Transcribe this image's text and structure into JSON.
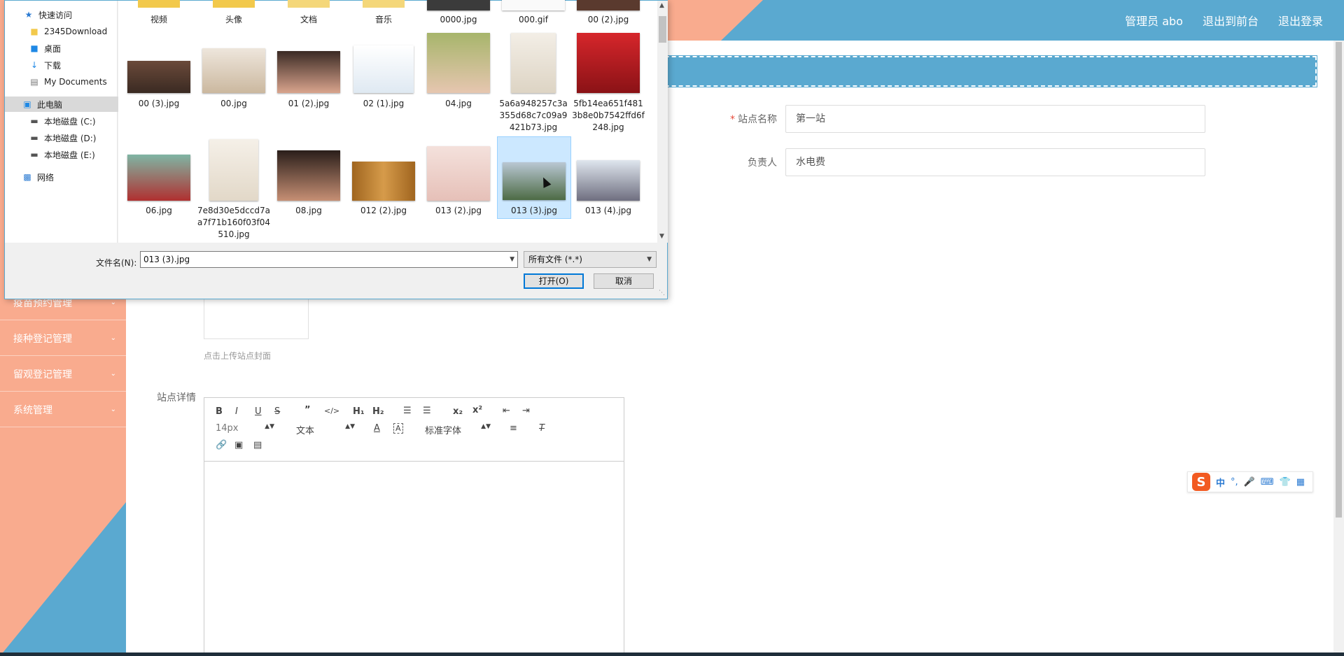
{
  "header": {
    "nav": [
      "管理员 abo",
      "退出到前台",
      "退出登录"
    ]
  },
  "sidebar": {
    "items": [
      {
        "label": "疫苗预约管理"
      },
      {
        "label": "接种登记管理"
      },
      {
        "label": "留观登记管理"
      },
      {
        "label": "系统管理"
      }
    ]
  },
  "form": {
    "station_name_label": "站点名称",
    "station_name_value": "第一站",
    "manager_label": "负责人",
    "manager_value": "水电费",
    "upload_hint": "点击上传站点封面",
    "detail_label": "站点详情"
  },
  "editor": {
    "font_size": "14px",
    "text_type": "文本",
    "font_family": "标准字体"
  },
  "file_dialog": {
    "nav": [
      {
        "label": "快速访问",
        "icon": "star-icon"
      },
      {
        "label": "2345Download",
        "icon": "folder-icon",
        "pinned": true
      },
      {
        "label": "桌面",
        "icon": "desktop-icon",
        "pinned": true
      },
      {
        "label": "下载",
        "icon": "download-icon",
        "pinned": true
      },
      {
        "label": "My Documents",
        "icon": "document-icon",
        "pinned": true
      },
      {
        "label": "此电脑",
        "icon": "computer-icon",
        "selected": true
      },
      {
        "label": "本地磁盘 (C:)",
        "icon": "drive-icon"
      },
      {
        "label": "本地磁盘 (D:)",
        "icon": "drive-icon"
      },
      {
        "label": "本地磁盘 (E:)",
        "icon": "drive-icon"
      },
      {
        "label": "网络",
        "icon": "network-icon"
      }
    ],
    "files": [
      {
        "name": "视频",
        "kind": "folder"
      },
      {
        "name": "头像",
        "kind": "folder"
      },
      {
        "name": "文档",
        "kind": "folder"
      },
      {
        "name": "音乐",
        "kind": "folder"
      },
      {
        "name": "0000.jpg",
        "kind": "image"
      },
      {
        "name": "000.gif",
        "kind": "image"
      },
      {
        "name": "00 (2).jpg",
        "kind": "image"
      },
      {
        "name": "00 (3).jpg",
        "kind": "image"
      },
      {
        "name": "00.jpg",
        "kind": "image"
      },
      {
        "name": "01 (2).jpg",
        "kind": "image"
      },
      {
        "name": "02 (1).jpg",
        "kind": "image"
      },
      {
        "name": "04.jpg",
        "kind": "image"
      },
      {
        "name": "5a6a948257c3a355d68c7c09a9421b73.jpg",
        "kind": "image"
      },
      {
        "name": "5fb14ea651f4813b8e0b7542ffd6f248.jpg",
        "kind": "image"
      },
      {
        "name": "06.jpg",
        "kind": "image"
      },
      {
        "name": "7e8d30e5dccd7aa7f71b160f03f04510.jpg",
        "kind": "image"
      },
      {
        "name": "08.jpg",
        "kind": "image"
      },
      {
        "name": "012 (2).jpg",
        "kind": "image"
      },
      {
        "name": "013 (2).jpg",
        "kind": "image"
      },
      {
        "name": "013 (3).jpg",
        "kind": "image",
        "selected": true
      },
      {
        "name": "013 (4).jpg",
        "kind": "image"
      }
    ],
    "filename_label": "文件名(N):",
    "filename_value": "013 (3).jpg",
    "filetype_value": "所有文件 (*.*)",
    "open_button": "打开(O)",
    "cancel_button": "取消"
  },
  "colors": {
    "accent_blue": "#5aa9d0",
    "salmon": "#f9ab8e",
    "required_red": "#e74c3c",
    "selection_blue": "#cce8ff"
  }
}
